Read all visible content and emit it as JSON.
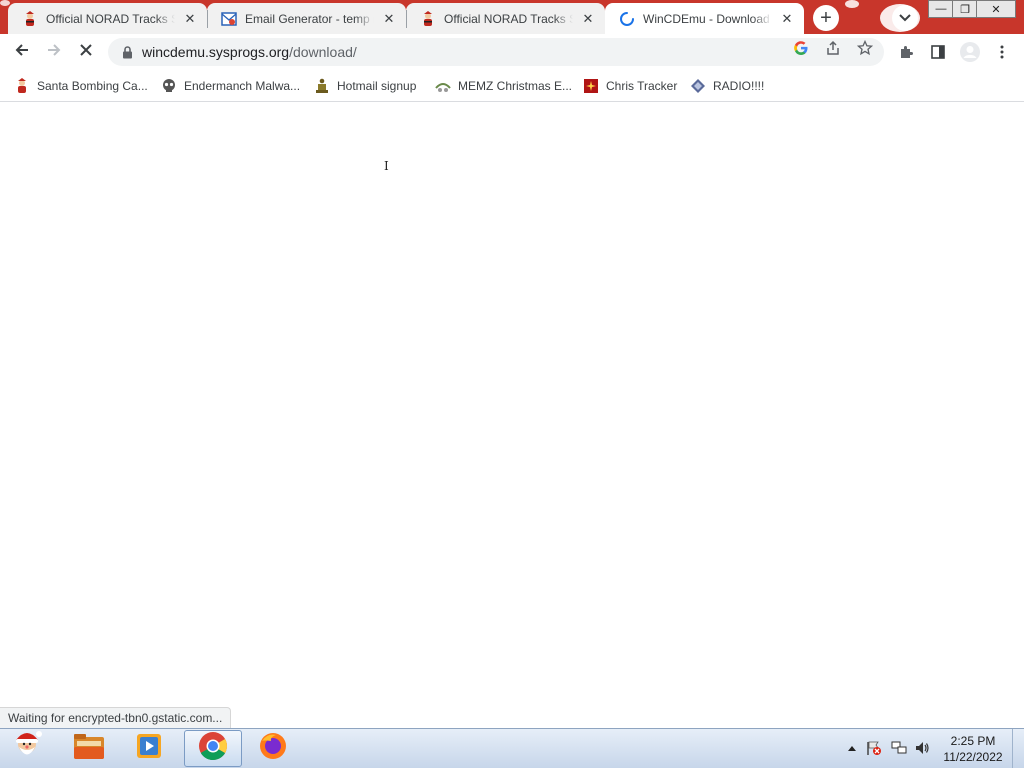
{
  "browser": {
    "tabs": [
      {
        "title": "Official NORAD Tracks Santa",
        "icon": "santa-icon",
        "active": false
      },
      {
        "title": "Email Generator - temp mail",
        "icon": "email-generator-icon",
        "active": false
      },
      {
        "title": "Official NORAD Tracks Santa",
        "icon": "santa-icon",
        "active": false
      },
      {
        "title": "WinCDEmu - Download",
        "icon": "loading-spinner-icon",
        "active": true
      }
    ],
    "new_tab_label": "+",
    "tab_search_label": "⌄",
    "window_controls": {
      "minimize": "—",
      "restore": "❐",
      "close": "✕"
    }
  },
  "toolbar": {
    "url_host": "wincdemu.sysprogs.org",
    "url_path": "/download/"
  },
  "bookmarks": [
    {
      "label": "Santa Bombing Ca...",
      "icon": "santa-icon"
    },
    {
      "label": "Endermanch Malwa...",
      "icon": "skull-icon"
    },
    {
      "label": "Hotmail signup",
      "icon": "figure-icon"
    },
    {
      "label": "MEMZ Christmas E...",
      "icon": "memz-icon"
    },
    {
      "label": "Chris Tracker",
      "icon": "tracker-icon"
    },
    {
      "label": "RADIO!!!!",
      "icon": "radio-icon"
    }
  ],
  "status_text": "Waiting for encrypted-tbn0.gstatic.com...",
  "taskbar": {
    "apps": [
      "santa-start-icon",
      "file-explorer-icon",
      "media-player-icon",
      "chrome-icon",
      "firefox-icon"
    ],
    "clock_time": "2:25 PM",
    "clock_date": "11/22/2022"
  },
  "colors": {
    "tabstrip_bg": "#c8362b",
    "omnibox_bg": "#f1f3f4",
    "taskbar_bg": "#dbe6f3"
  }
}
